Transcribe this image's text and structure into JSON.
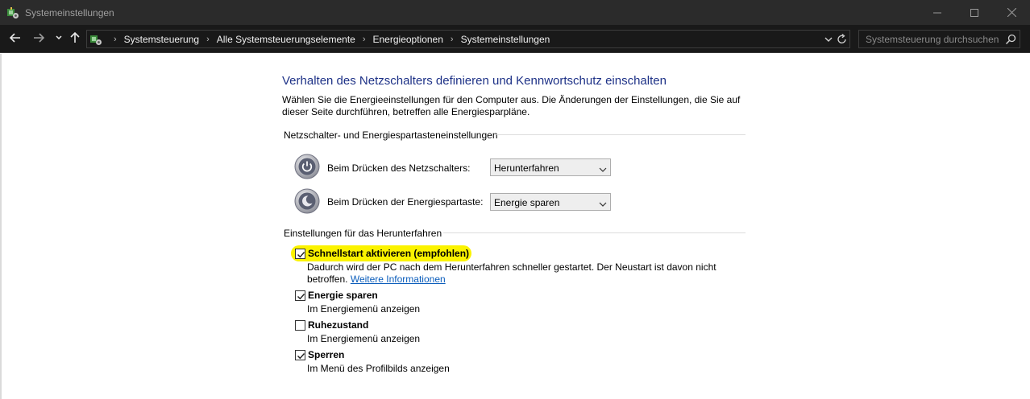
{
  "window": {
    "title": "Systemeinstellungen",
    "app_icon": "control-panel-icon",
    "controls": [
      "minimize-icon",
      "maximize-icon",
      "close-icon"
    ]
  },
  "navbar": {
    "breadcrumbs": [
      "Systemsteuerung",
      "Alle Systemsteuerungselemente",
      "Energieoptionen",
      "Systemeinstellungen"
    ],
    "search_placeholder": "Systemsteuerung durchsuchen"
  },
  "main": {
    "heading": "Verhalten des Netzschalters definieren und Kennwortschutz einschalten",
    "description": "Wählen Sie die Energieeinstellungen für den Computer aus. Die Änderungen der Einstellungen, die Sie auf dieser Seite durchführen, betreffen alle Energiesparpläne.",
    "power_group": {
      "title": "Netzschalter- und Energiespartasteneinstellungen",
      "rows": [
        {
          "label": "Beim Drücken des Netzschalters:",
          "value": "Herunterfahren",
          "icon": "power-button-icon"
        },
        {
          "label": "Beim Drücken der Energiespartaste:",
          "value": "Energie sparen",
          "icon": "sleep-button-icon"
        }
      ]
    },
    "shutdown_group": {
      "title": "Einstellungen für das Herunterfahren",
      "fast_startup": {
        "label": "Schnellstart aktivieren (empfohlen)",
        "checked": true,
        "desc_text": "Dadurch wird der PC nach dem Herunterfahren schneller gestartet. Der Neustart ist davon nicht betroffen. ",
        "link": "Weitere Informationen",
        "highlight_color": "#fbf300"
      },
      "options": [
        {
          "label": "Energie sparen",
          "desc": "Im Energiemenü anzeigen",
          "checked": true
        },
        {
          "label": "Ruhezustand",
          "desc": "Im Energiemenü anzeigen",
          "checked": false
        },
        {
          "label": "Sperren",
          "desc": "Im Menü des Profilbilds anzeigen",
          "checked": true
        }
      ]
    }
  }
}
